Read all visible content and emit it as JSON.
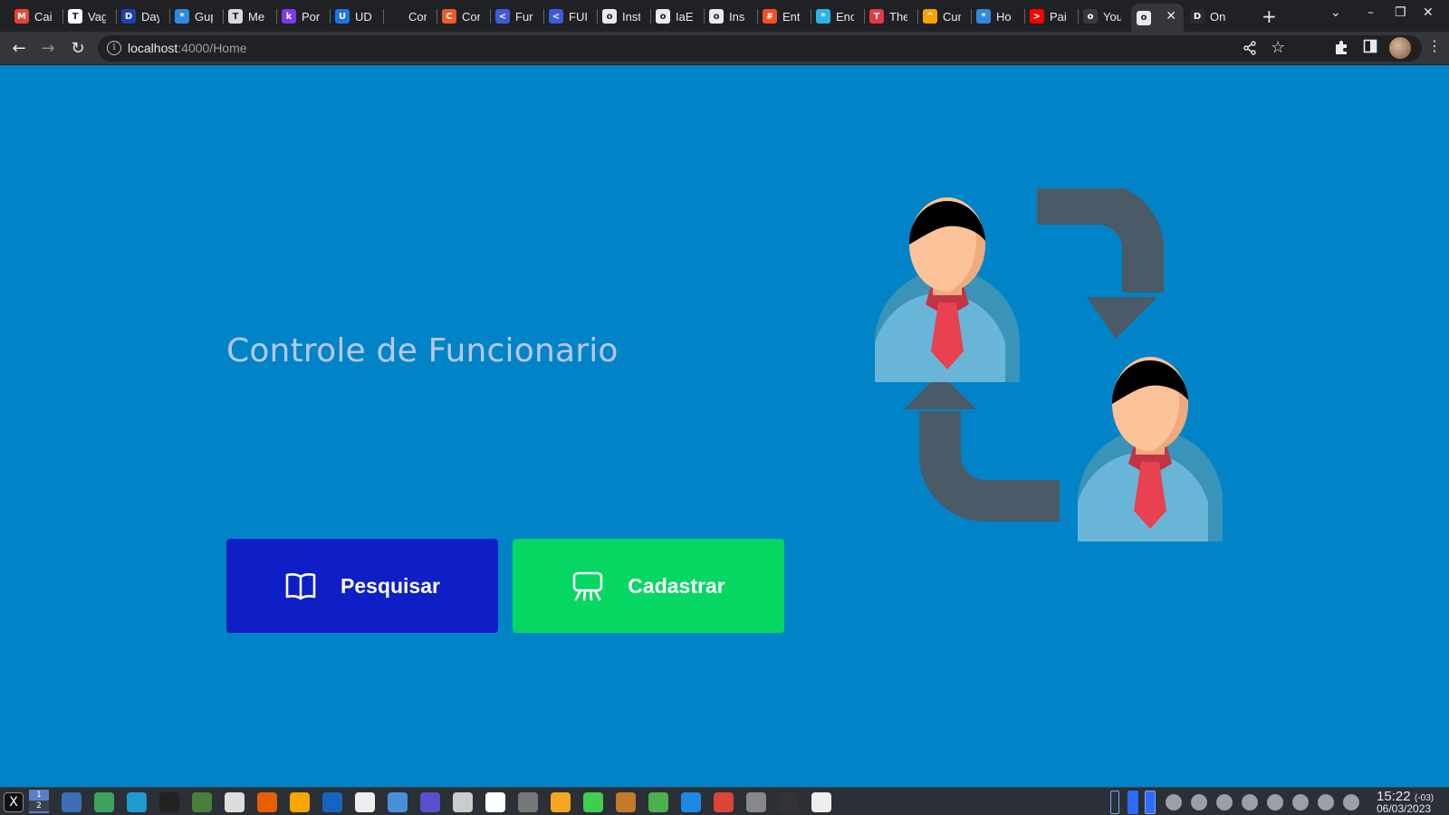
{
  "browser": {
    "tabs": [
      {
        "title": "Caixa",
        "icon": "gmail-icon",
        "color": "#ea4335",
        "glyph": "M"
      },
      {
        "title": "Vagas",
        "icon": "trello-icon",
        "color": "#ffffff",
        "glyph": "T"
      },
      {
        "title": "Day",
        "icon": "d-icon",
        "color": "#1e40af",
        "glyph": "D"
      },
      {
        "title": "Gup",
        "icon": "gupy-icon",
        "color": "#2f8ae0",
        "glyph": "*"
      },
      {
        "title": "Me",
        "icon": "hammer-icon",
        "color": "#d9d9d9",
        "glyph": "T"
      },
      {
        "title": "Por",
        "icon": "k-icon",
        "color": "#7c3aed",
        "glyph": "k"
      },
      {
        "title": "UD",
        "icon": "udemy-icon",
        "color": "#1a73e8",
        "glyph": "U"
      },
      {
        "title": "Cor",
        "icon": "blank-icon",
        "color": "#202124",
        "glyph": ""
      },
      {
        "title": "Cor",
        "icon": "swirl-icon",
        "color": "#f05a28",
        "glyph": "C"
      },
      {
        "title": "Fur",
        "icon": "angular-icon",
        "color": "#3b5bdb",
        "glyph": "<"
      },
      {
        "title": "FUI",
        "icon": "angular-icon",
        "color": "#3b5bdb",
        "glyph": "<"
      },
      {
        "title": "Inst",
        "icon": "globe-icon",
        "color": "#e8eaed",
        "glyph": "o"
      },
      {
        "title": "IaE",
        "icon": "globe-icon",
        "color": "#e8eaed",
        "glyph": "o"
      },
      {
        "title": "Ins",
        "icon": "globe-icon",
        "color": "#e8eaed",
        "glyph": "o"
      },
      {
        "title": "Ent",
        "icon": "microsoft-icon",
        "color": "#f25022",
        "glyph": "#"
      },
      {
        "title": "Enc",
        "icon": "snowflake-icon",
        "color": "#29b5e8",
        "glyph": "*"
      },
      {
        "title": "The",
        "icon": "t-icon",
        "color": "#e63946",
        "glyph": "T"
      },
      {
        "title": "Cur",
        "icon": "graduation-icon",
        "color": "#f4a300",
        "glyph": "^"
      },
      {
        "title": "Ho",
        "icon": "sparkle-icon",
        "color": "#2f8ae0",
        "glyph": "*"
      },
      {
        "title": "Pai",
        "icon": "youtube-icon",
        "color": "#ff0000",
        "glyph": ">"
      },
      {
        "title": "You",
        "icon": "github-icon",
        "color": "#3a3a3a",
        "glyph": "o"
      },
      {
        "title": "",
        "icon": "globe-icon",
        "color": "#e8eaed",
        "glyph": "o",
        "active": true
      },
      {
        "title": "On",
        "icon": "d-icon",
        "color": "#2b2b2b",
        "glyph": "D"
      }
    ],
    "url_host": "localhost",
    "url_path": ":4000/Home"
  },
  "page": {
    "title": "Controle de Funcionario",
    "buttons": {
      "search_label": "Pesquisar",
      "register_label": "Cadastrar"
    }
  },
  "colors": {
    "background": "#0084c7",
    "search_button": "#0d1fc5",
    "register_button": "#06d662",
    "title": "#b8c8f5"
  },
  "taskbar": {
    "workspace_labels": [
      "1",
      "2"
    ],
    "time": "15:22",
    "timezone": "(-03)",
    "date": "06/03/2023"
  }
}
